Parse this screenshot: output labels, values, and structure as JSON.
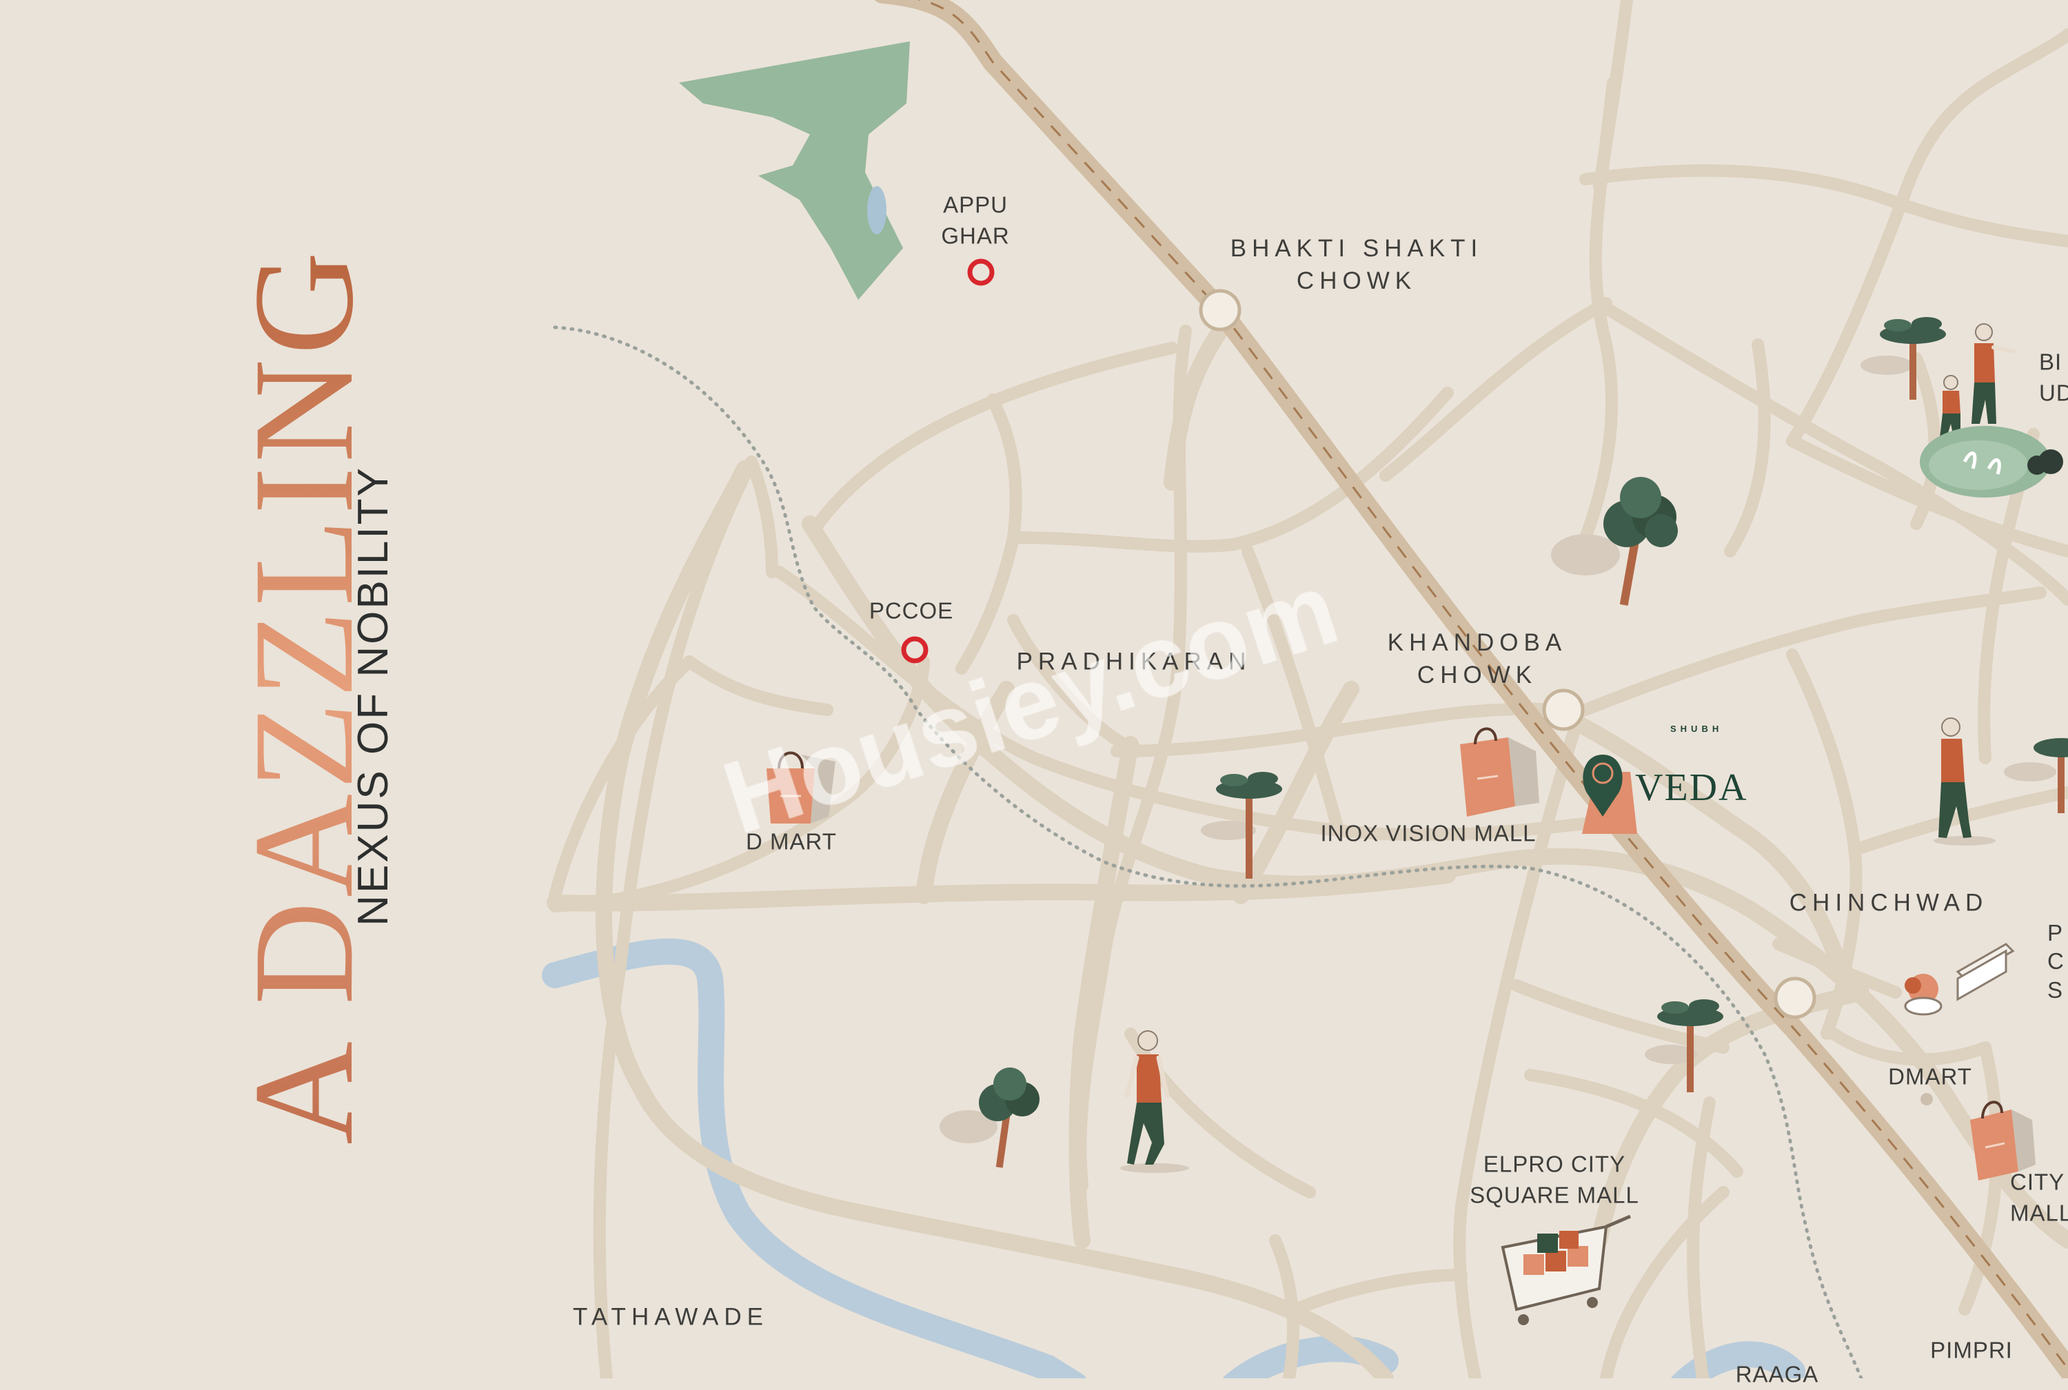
{
  "headline": {
    "main": "A DAZZLING",
    "sub": "NEXUS OF NOBILITY"
  },
  "watermark": "Housiey.com",
  "project": {
    "brand_small": "SHUBH",
    "brand_name": "VEDA"
  },
  "landmarks": {
    "appu_ghar": "APPU\nGHAR",
    "pccoe": "PCCOE",
    "d_mart": "D MART",
    "inox": "INOX VISION MALL",
    "elpro": "ELPRO CITY\nSQUARE MALL",
    "dmart_right": "DMART",
    "city_mall": "CITY\nMALL",
    "pimpri": "PIMPRI",
    "raaga": "RAAGA",
    "bird_udyan_partial": "BI\nUD",
    "park_partial": "P\nC\nS"
  },
  "areas": {
    "bhakti_shakti": "BHAKTI SHAKTI\nCHOWK",
    "pradhikaran": "PRADHIKARAN",
    "khandoba": "KHANDOBA\nCHOWK",
    "chinchwad": "CHINCHWAD",
    "tathawade": "TATHAWADE"
  },
  "colors": {
    "background": "#eae3d9",
    "road": "#ddd1bf",
    "highway": "#d2bea4",
    "river": "#b9ccdb",
    "park": "#96b89c",
    "accent_orange": "#e08e6d",
    "marker_red": "#d8262d",
    "tree_green": "#3d5c4b",
    "brand_green": "#1f4536"
  },
  "icons": {
    "metro_marker": "red-ring-marker",
    "junction": "junction-dot",
    "shopping": "shopping-bag-icon",
    "tree": "tree-icon",
    "walker": "walking-person-icon",
    "cart": "shopping-cart-icon",
    "location": "location-pin-icon",
    "bench": "bench-icon"
  }
}
